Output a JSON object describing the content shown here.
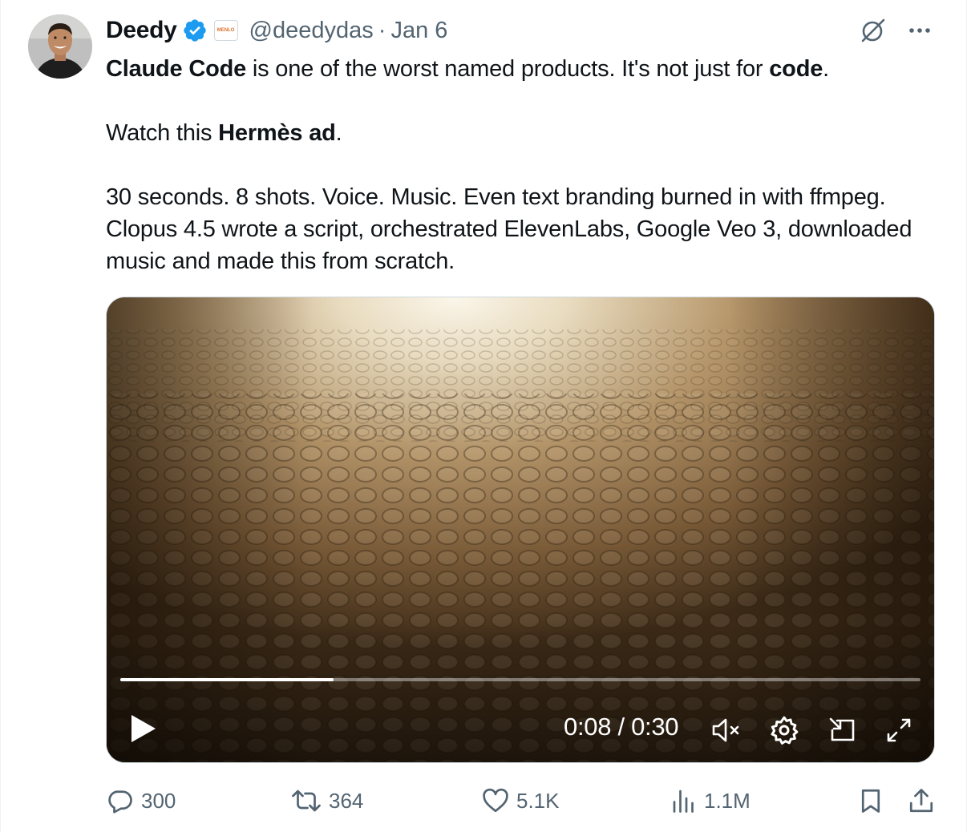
{
  "author": {
    "name": "Deedy",
    "handle": "@deedydas",
    "separator": "·",
    "date": "Jan 6",
    "affiliate_label": "MENLO"
  },
  "tweet": {
    "line1_bold_a": "Claude Code",
    "line1_mid": " is one of the worst named products. It's not just for ",
    "line1_bold_b": "code",
    "line1_end": ".",
    "line2_start": "Watch this ",
    "line2_bold": "Hermès ad",
    "line2_end": ".",
    "line3": "30 seconds. 8 shots. Voice. Music. Even text branding burned in with ffmpeg. Clopus 4.5 wrote a script, orchestrated ElevenLabs, Google Veo 3, downloaded music and made this from scratch."
  },
  "video": {
    "time_display": "0:08 / 0:30",
    "progress_fraction": 0.2667
  },
  "actions": {
    "replies": "300",
    "reposts": "364",
    "likes": "5.1K",
    "views": "1.1M"
  },
  "icons": {
    "verified": "verified-badge-icon",
    "grok": "grok-icon",
    "more": "more-icon",
    "play": "play-icon",
    "mute": "mute-icon",
    "settings": "settings-icon",
    "pip": "picture-in-picture-icon",
    "fullscreen": "fullscreen-icon",
    "reply": "reply-icon",
    "repost": "repost-icon",
    "like": "like-icon",
    "views": "views-icon",
    "bookmark": "bookmark-icon",
    "share": "share-icon"
  },
  "colors": {
    "verified_blue": "#1d9bf0",
    "secondary_text": "#536471",
    "primary_text": "#0f1419"
  }
}
